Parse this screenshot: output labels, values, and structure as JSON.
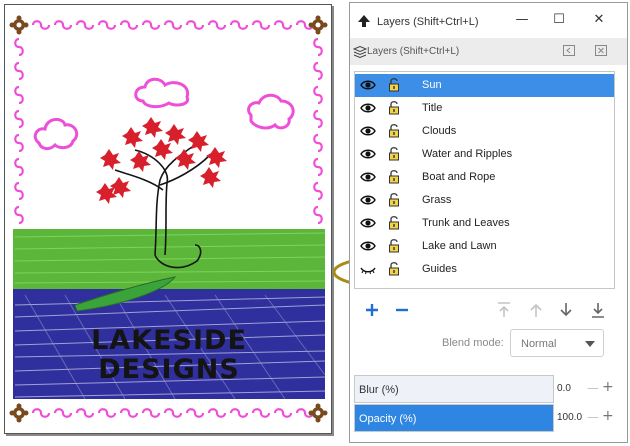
{
  "poster": {
    "title_line1": "LAKESIDE",
    "title_line2": "DESIGNS"
  },
  "dialog": {
    "window_title": "Layers (Shift+Ctrl+L)",
    "tab_label": "Layers (Shift+Ctrl+L)",
    "window_buttons": [
      "—",
      "☐",
      "✕"
    ],
    "layers": [
      {
        "name": "Sun",
        "selected": true,
        "visible": true,
        "unlocked": true
      },
      {
        "name": "Title",
        "selected": false,
        "visible": true,
        "unlocked": true
      },
      {
        "name": "Clouds",
        "selected": false,
        "visible": true,
        "unlocked": true
      },
      {
        "name": "Water and Ripples",
        "selected": false,
        "visible": true,
        "unlocked": true
      },
      {
        "name": "Boat and Rope",
        "selected": false,
        "visible": true,
        "unlocked": true
      },
      {
        "name": "Grass",
        "selected": false,
        "visible": true,
        "unlocked": true
      },
      {
        "name": "Trunk and Leaves",
        "selected": false,
        "visible": true,
        "unlocked": true
      },
      {
        "name": "Lake and Lawn",
        "selected": false,
        "visible": true,
        "unlocked": true
      },
      {
        "name": "Guides",
        "selected": false,
        "visible": false,
        "unlocked": true
      }
    ],
    "toolbar_icons": [
      "add-layer-icon",
      "remove-layer-icon",
      "move-to-top-icon",
      "raise-layer-icon",
      "lower-layer-icon",
      "move-to-bottom-icon"
    ],
    "blend_mode": {
      "label": "Blend mode:",
      "value": "Normal"
    },
    "blur": {
      "label": "Blur (%)",
      "value": "0.0",
      "level": 0.0
    },
    "opacity": {
      "label": "Opacity (%)",
      "value": "100.0",
      "level": 1.0
    }
  },
  "colors": {
    "selection": "#3d8ee6",
    "slider_fill": "#2e86e2",
    "highlight_ring": "#a78c1a",
    "grass": "#5bb63a",
    "water": "#2f2f9e",
    "cloud_pink": "#ee4fd8",
    "leaf_red": "#d81f2c",
    "frame_brown": "#7a4a1f"
  }
}
